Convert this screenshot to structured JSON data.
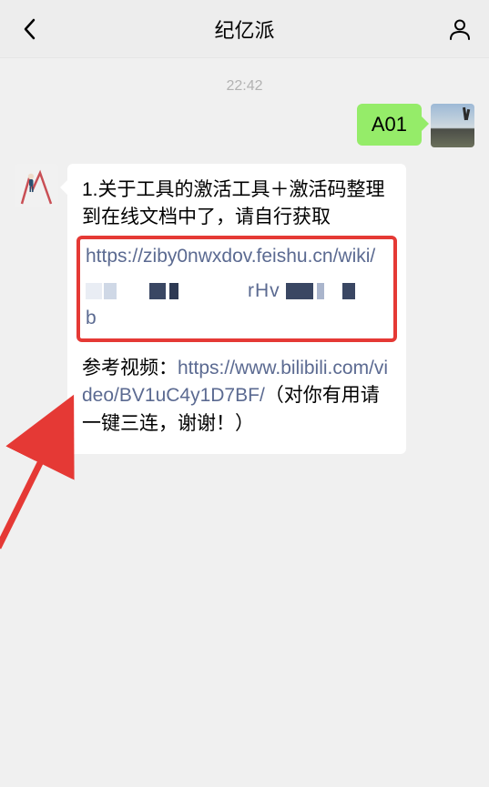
{
  "header": {
    "title": "纪亿派"
  },
  "chat": {
    "timestamp": "22:42",
    "outgoing": {
      "text": "A01"
    },
    "incoming": {
      "line1": "1.关于工具的激活工具＋激活码整理到在线文档中了，请自行获取",
      "highlighted_url_prefix": "https://ziby0nwxdov.feishu.cn/wiki/",
      "highlighted_mid_fragment": "rHv",
      "highlighted_trailing": "b",
      "ref_label": "参考视频：",
      "ref_url": "https://www.bilibili.com/video/BV1uC4y1D7BF/",
      "ref_suffix": "（对你有用请一键三连，谢谢！）"
    }
  },
  "colors": {
    "accent_green": "#95ec69",
    "highlight_red": "#e53935",
    "link_color": "#5b6a91"
  }
}
